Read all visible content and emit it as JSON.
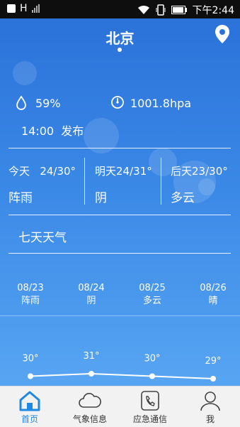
{
  "status_bar": {
    "network": "H",
    "time": "下午2:44"
  },
  "header": {
    "city": "北京"
  },
  "current": {
    "humidity": "59%",
    "pressure": "1001.8hpa",
    "publish_time": "14:00",
    "publish_label": "发布"
  },
  "days": [
    {
      "label": "今天",
      "temp": "24/30°",
      "weather": "阵雨"
    },
    {
      "label": "明天",
      "temp": "24/31°",
      "weather": "阴"
    },
    {
      "label": "后天",
      "temp": "23/30°",
      "weather": "多云"
    }
  ],
  "seven_day_title": "七天天气",
  "forecast": [
    {
      "date": "08/23",
      "weather": "阵雨",
      "temp": "30°"
    },
    {
      "date": "08/24",
      "weather": "阴",
      "temp": "31°"
    },
    {
      "date": "08/25",
      "weather": "多云",
      "temp": "30°"
    },
    {
      "date": "08/26",
      "weather": "晴",
      "temp": "29°"
    }
  ],
  "chart_data": {
    "type": "line",
    "categories": [
      "08/23",
      "08/24",
      "08/25",
      "08/26"
    ],
    "series": [
      {
        "values": [
          30,
          31,
          30,
          29
        ]
      }
    ]
  },
  "tabs": [
    {
      "label": "首页",
      "icon": "home-icon",
      "active": true
    },
    {
      "label": "气象信息",
      "icon": "cloud-icon",
      "active": false
    },
    {
      "label": "应急通信",
      "icon": "phone-icon",
      "active": false
    },
    {
      "label": "我",
      "icon": "user-icon",
      "active": false
    }
  ],
  "colors": {
    "accent": "#1e88e5",
    "tab_text": "#333333"
  }
}
